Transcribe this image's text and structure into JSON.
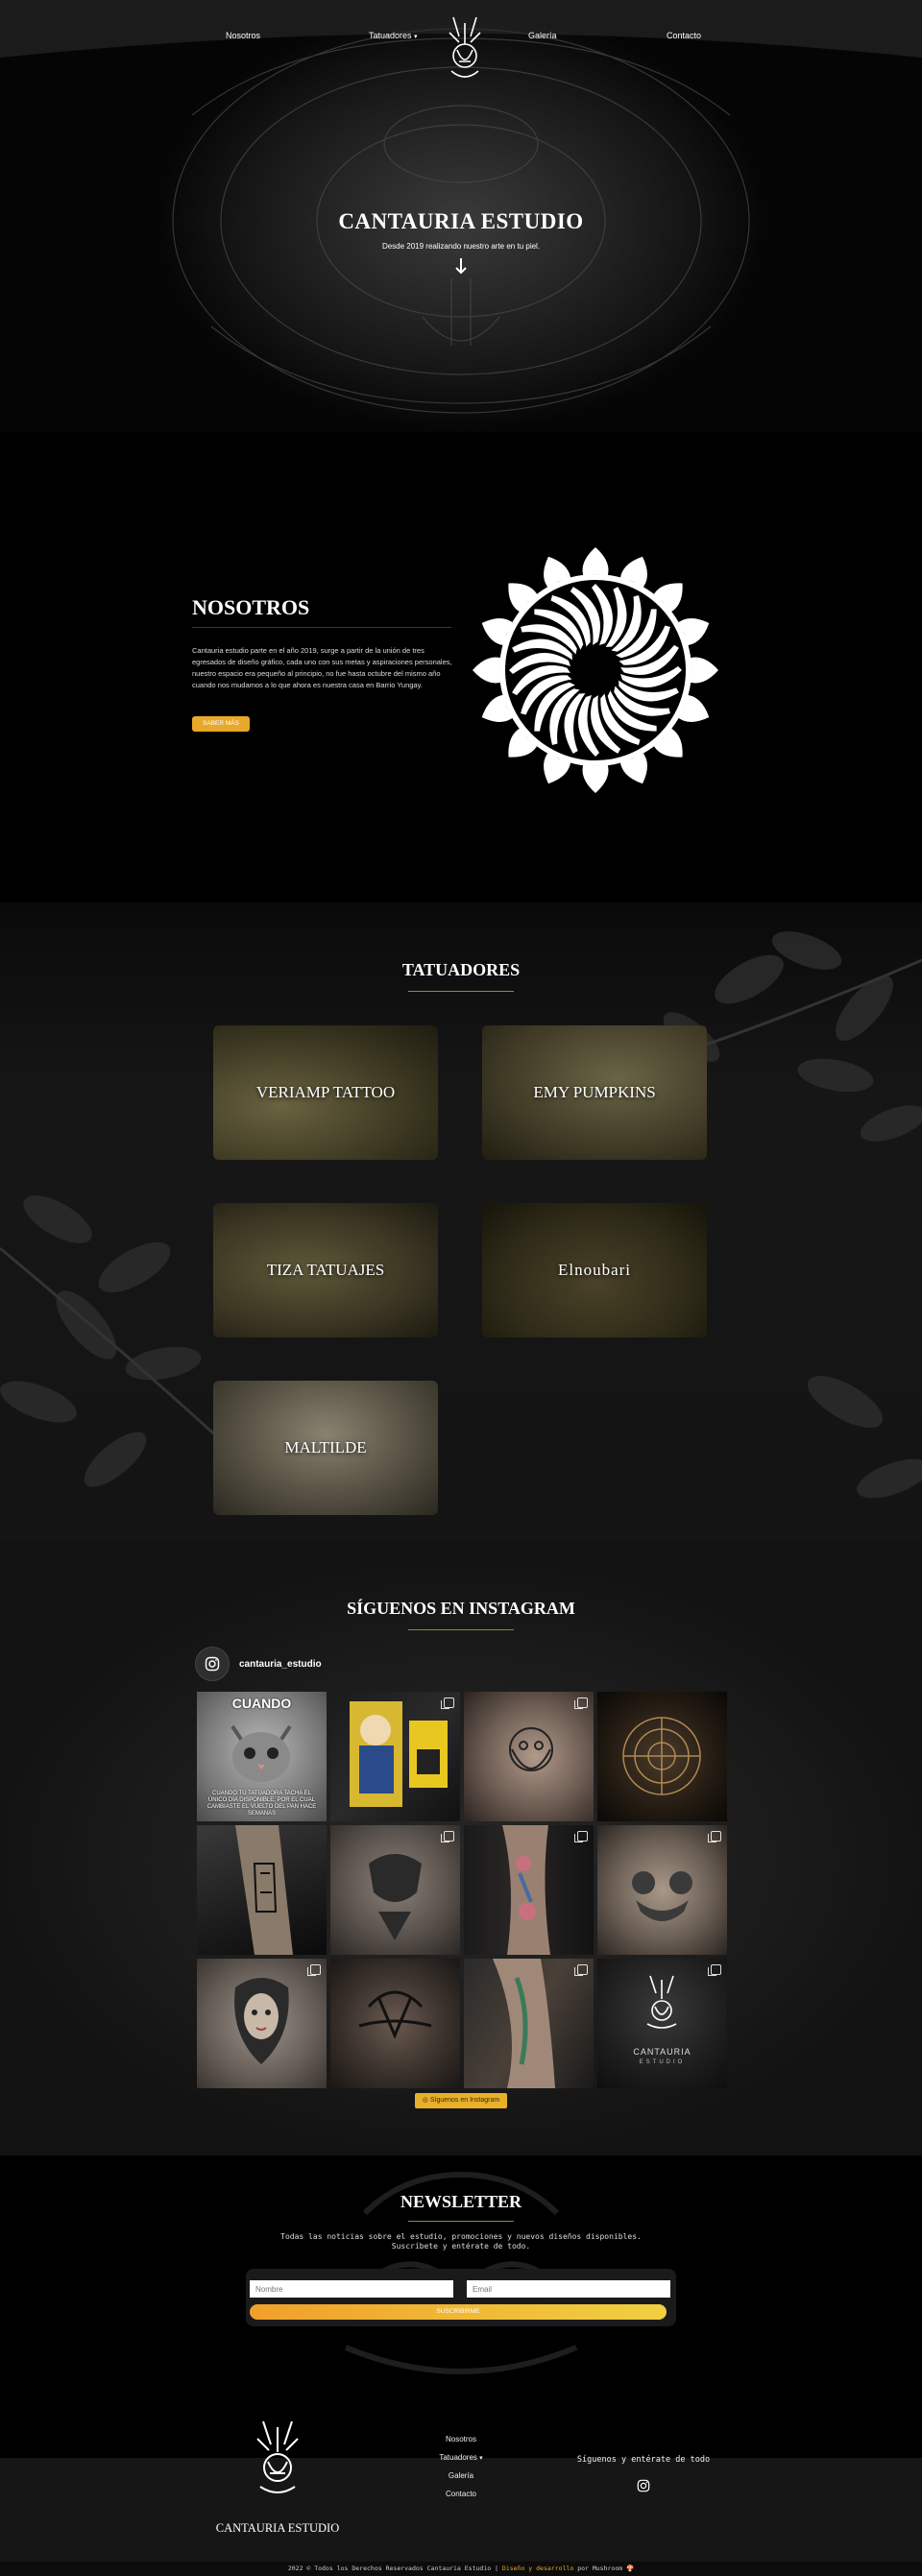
{
  "nav": {
    "items": [
      "Nosotros",
      "Tatuadores",
      "Galería",
      "Contacto"
    ],
    "dropdown_icon": "caret-down-icon",
    "logo_icon": "spider-logo-icon"
  },
  "hero": {
    "title": "CANTAURIA ESTUDIO",
    "subtitle": "Desde 2019 realizando nuestro arte en tu piel.",
    "arrow_icon": "arrow-down-icon"
  },
  "nosotros": {
    "title": "NOSOTROS",
    "text": "Cantauria estudio parte en el año 2019, surge a partir de la unión de tres egresados de diseño gráfico, cada uno con sus metas y aspiraciones personales, nuestro espacio era pequeño al principio, no fue hasta octubre del mismo año cuando nos mudamos a lo que ahora es nuestra casa en Barrio Yungay.",
    "button": "SABER MÁS"
  },
  "tatuadores": {
    "title": "TATUADORES",
    "artists": [
      "VERIAMP TATTOO",
      "EMY PUMPKINS",
      "TIZA TATUAJES",
      "Elnoubari",
      "MALTILDE"
    ]
  },
  "instagram": {
    "title": "SÍGUENOS EN INSTAGRAM",
    "username": "cantauria_estudio",
    "meme_top": "CUANDO",
    "meme_bottom": "CUANDO TU TATUADORA TACHA EL ÚNICO DÍA DISPONIBLE, POR EL CUAL CAMBIASTE EL VUELTO DEL PAN HACE SEMANAS",
    "logo_tile_text": "CANTAURIA",
    "logo_tile_sub": "ESTUDIO",
    "follow_button": "Síguenos en Instagram",
    "icon": "instagram-icon"
  },
  "newsletter": {
    "title": "NEWSLETTER",
    "text": "Todas las noticias sobre el estudio, promociones y nuevos diseños disponibles.\nSuscríbete y entérate de todo.",
    "name_placeholder": "Nombre",
    "email_placeholder": "Email",
    "button": "SUSCRIBIRME"
  },
  "footer": {
    "brand": "CANTAURIA ESTUDIO",
    "links": [
      "Nosotros",
      "Tatuadores",
      "Galería",
      "Contacto"
    ],
    "follow_text": "Síguenos y entérate de todo",
    "copyright_pre": "2022 © Todos los Derechos Reservados Cantauria Estudio |",
    "copyright_hl": "Diseño y desarrollo",
    "copyright_post": "por Mushroom 🍄"
  },
  "colors": {
    "accent": "#e8a82a",
    "background": "#000000"
  }
}
